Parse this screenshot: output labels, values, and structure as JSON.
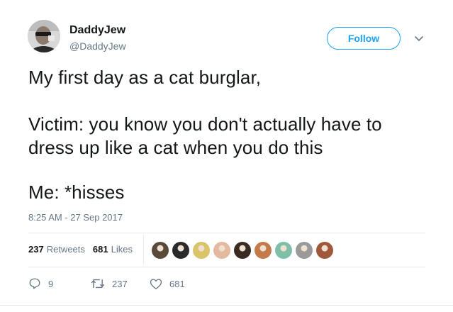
{
  "user": {
    "display_name": "DaddyJew",
    "handle": "@DaddyJew"
  },
  "follow_label": "Follow",
  "tweet": {
    "lines": [
      "My first day as a cat burglar,",
      "Victim: you know you don't actually have to",
      "dress up like a cat when you do this",
      "Me: *hisses"
    ],
    "timestamp": "8:25 AM - 27 Sep 2017"
  },
  "stats": {
    "retweets_count": "237",
    "retweets_label": "Retweets",
    "likes_count": "681",
    "likes_label": "Likes"
  },
  "likers": [
    {
      "icon": "liker-avatar",
      "color": "#5a4a3a"
    },
    {
      "icon": "liker-avatar",
      "color": "#2a2a2a"
    },
    {
      "icon": "liker-avatar",
      "color": "#d9c46a"
    },
    {
      "icon": "liker-avatar",
      "color": "#e3b9a0"
    },
    {
      "icon": "liker-avatar",
      "color": "#3a2c22"
    },
    {
      "icon": "liker-avatar",
      "color": "#c47a4a"
    },
    {
      "icon": "liker-avatar",
      "color": "#7fbfa8"
    },
    {
      "icon": "liker-avatar",
      "color": "#9a9a9a"
    },
    {
      "icon": "liker-avatar",
      "color": "#a0583a"
    }
  ],
  "actions": {
    "reply_count": "9",
    "retweet_count": "237",
    "like_count": "681"
  },
  "colors": {
    "accent": "#1da1f2",
    "text": "#14171a",
    "muted": "#657786",
    "divider": "#e6ecf0"
  }
}
